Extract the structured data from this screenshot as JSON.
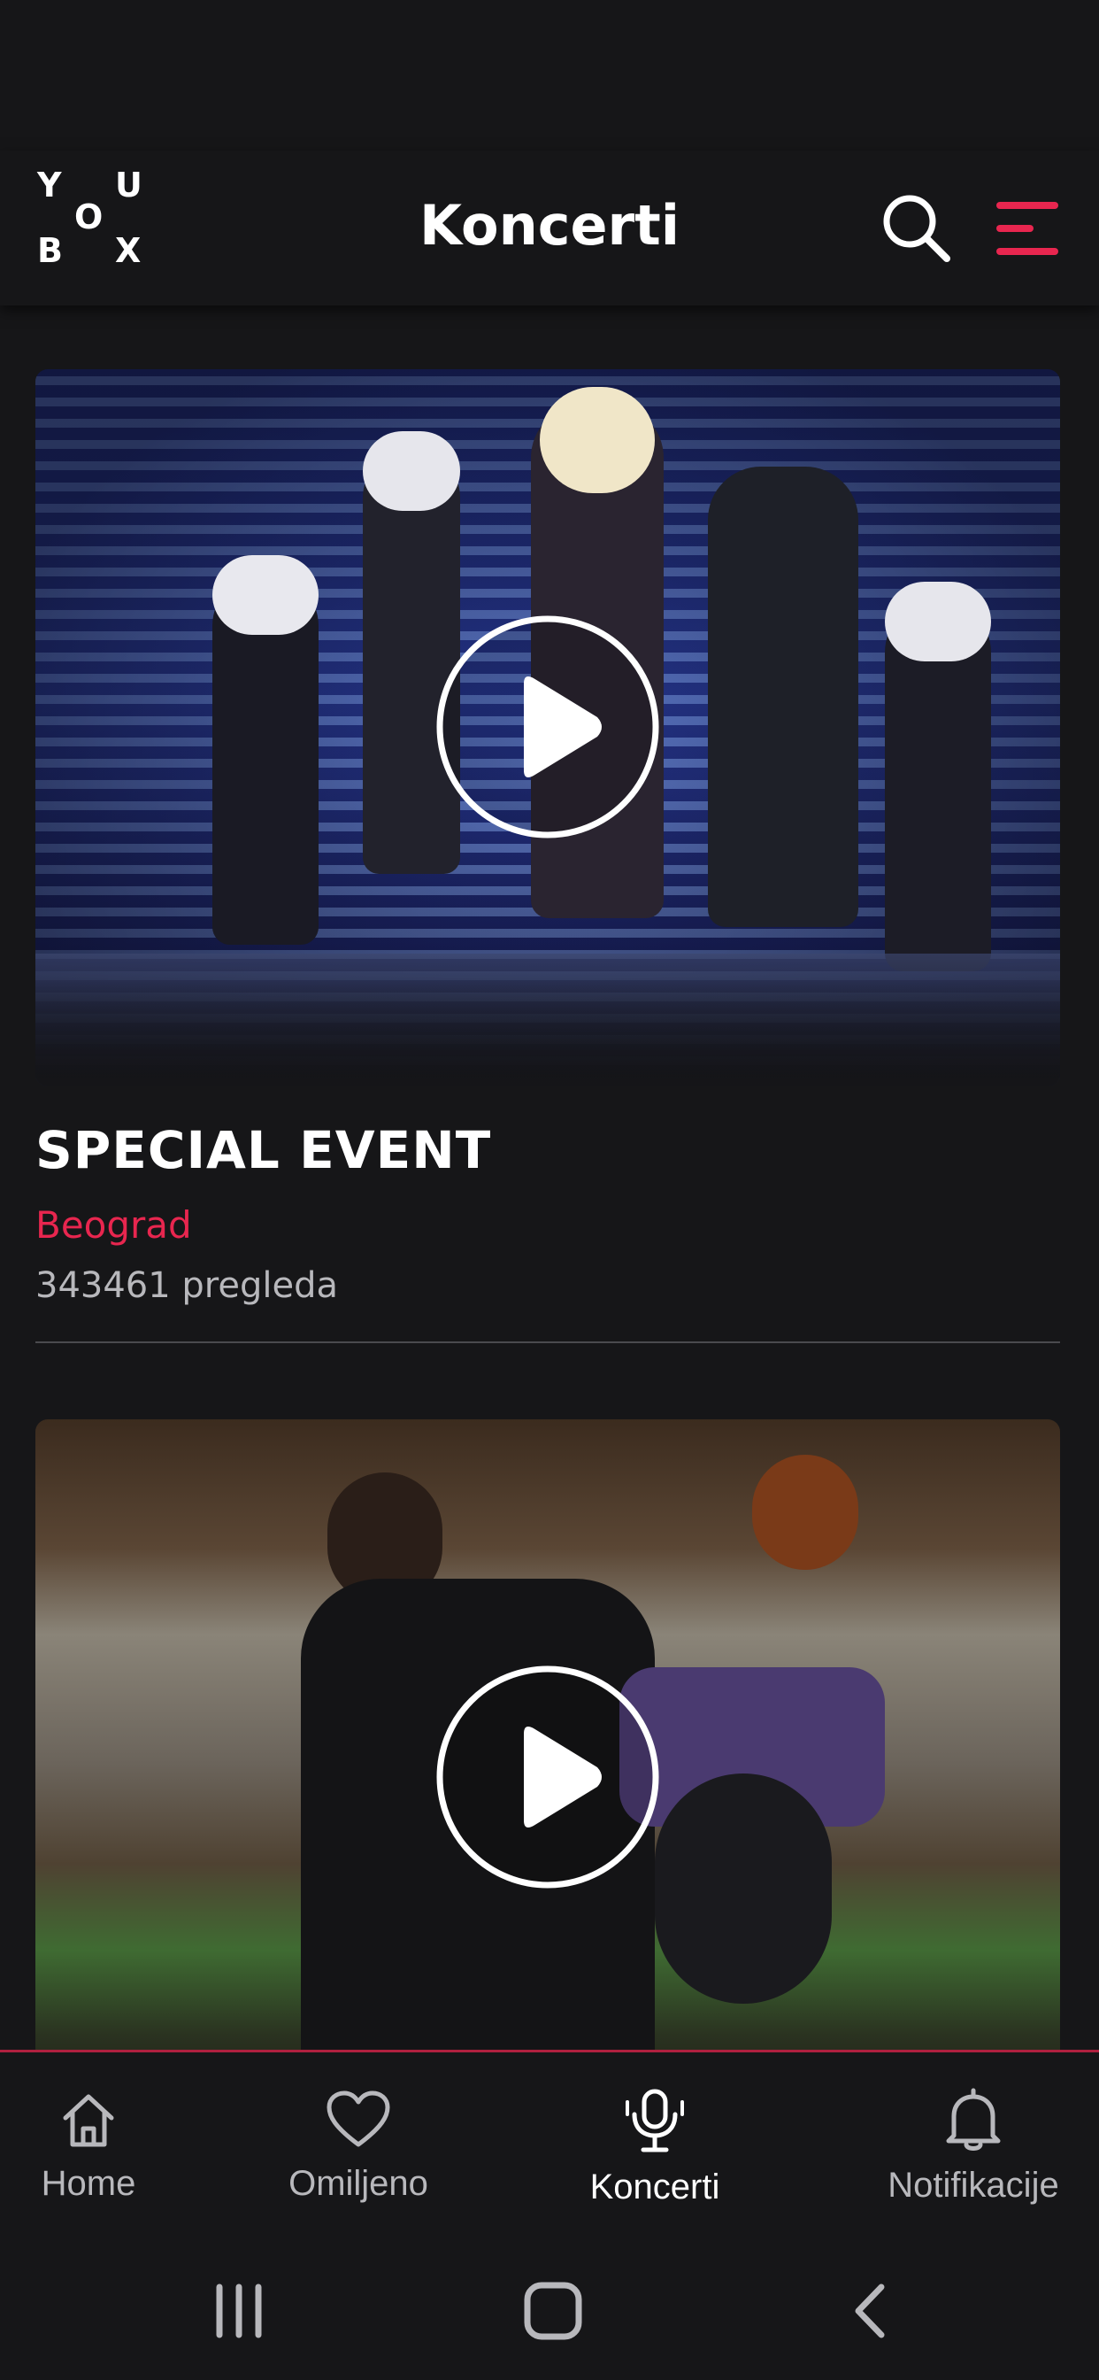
{
  "header": {
    "logo_letters": [
      "Y",
      "O",
      "U",
      "B",
      "X"
    ],
    "title": "Koncerti"
  },
  "concerts": [
    {
      "title": "SPECIAL EVENT",
      "location": "Beograd",
      "views": "343461 pregleda"
    },
    {
      "title": "",
      "location": "",
      "views": ""
    }
  ],
  "bottom_nav": {
    "items": [
      {
        "label": "Home",
        "icon": "home-icon"
      },
      {
        "label": "Omiljeno",
        "icon": "heart-icon"
      },
      {
        "label": "Koncerti",
        "icon": "microphone-icon",
        "active": true
      },
      {
        "label": "Notifikacije",
        "icon": "bell-icon"
      }
    ]
  },
  "colors": {
    "background": "#161618",
    "accent": "#e8264f",
    "text": "#ffffff",
    "muted": "#b8b8bc"
  }
}
